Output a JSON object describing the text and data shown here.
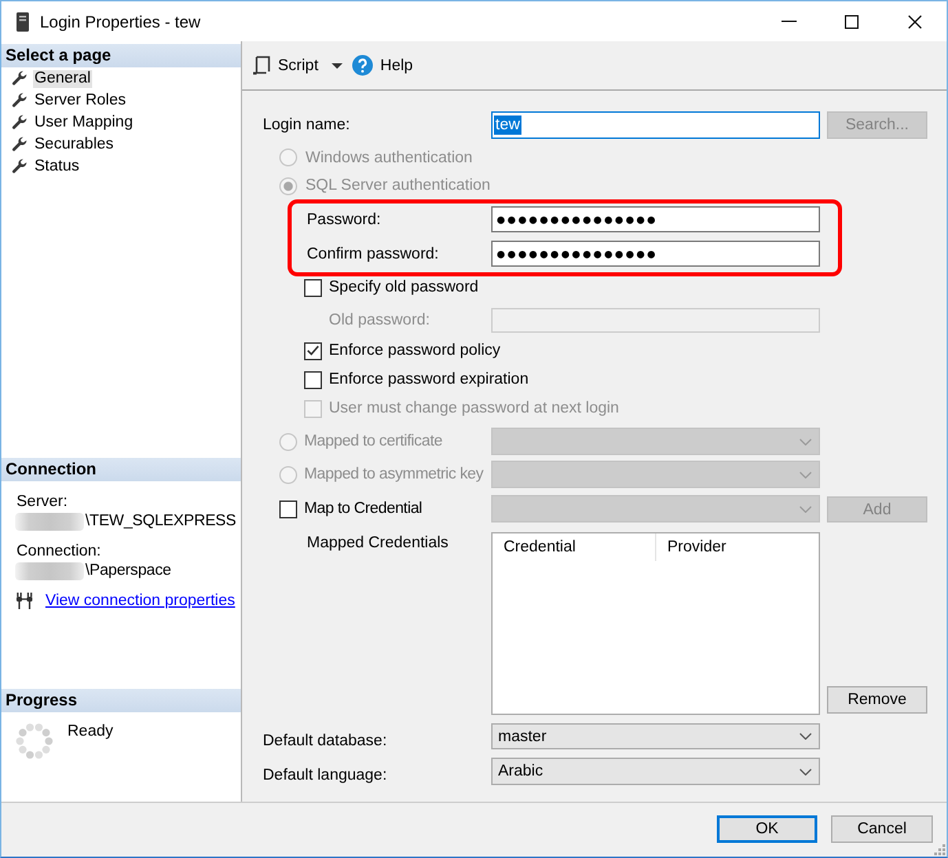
{
  "window": {
    "title": "Login Properties - tew"
  },
  "select_page": {
    "title": "Select a page",
    "items": [
      {
        "label": "General",
        "selected": true
      },
      {
        "label": "Server Roles",
        "selected": false
      },
      {
        "label": "User Mapping",
        "selected": false
      },
      {
        "label": "Securables",
        "selected": false
      },
      {
        "label": "Status",
        "selected": false
      }
    ]
  },
  "connection": {
    "title": "Connection",
    "lines": [
      {
        "kind": "caption",
        "text": "Server:",
        "redacted": false
      },
      {
        "kind": "detail",
        "text": "\\TEW_SQLEXPRESS",
        "redacted": true
      },
      {
        "kind": "caption",
        "text": "Connection:",
        "redacted": false
      },
      {
        "kind": "detail",
        "text": "\\Paperspace",
        "redacted": true
      }
    ],
    "link": "View connection properties"
  },
  "progress": {
    "title": "Progress",
    "status": "Ready"
  },
  "toolbar": [
    {
      "kind": "script",
      "label": "Script"
    },
    {
      "kind": "help",
      "label": "Help"
    }
  ],
  "login_name": {
    "label": "Login name:",
    "value": "tew",
    "value_selected": true,
    "button": {
      "label": "Search...",
      "disabled": true
    }
  },
  "authentication": [
    {
      "label": "Windows authentication",
      "selected": false,
      "disabled": true
    },
    {
      "label": "SQL Server authentication",
      "selected": true,
      "disabled": true
    }
  ],
  "password_group": {
    "highlighted": true,
    "fields": [
      {
        "label": "Password:",
        "value": "●●●●●●●●●●●●●●●"
      },
      {
        "label": "Confirm password:",
        "value": "●●●●●●●●●●●●●●●"
      }
    ]
  },
  "old_password": {
    "checkbox": {
      "label": "Specify old password",
      "checked": false
    },
    "label": "Old password:",
    "disabled": true
  },
  "policy_options": [
    {
      "label": "Enforce password policy",
      "checked": true,
      "disabled": false
    },
    {
      "label": "Enforce password expiration",
      "checked": false,
      "disabled": false
    },
    {
      "label": "User must change password at next login",
      "checked": false,
      "disabled": true
    }
  ],
  "mapping": [
    {
      "kind": "radio",
      "label": "Mapped to certificate",
      "selected": false,
      "disabled": true,
      "dropdown_disabled": true
    },
    {
      "kind": "radio",
      "label": "Mapped to asymmetric key",
      "selected": false,
      "disabled": true,
      "dropdown_disabled": true
    },
    {
      "kind": "checkbox",
      "label": "Map to Credential",
      "checked": false,
      "disabled": false,
      "dropdown_disabled": true,
      "button": {
        "label": "Add",
        "disabled": true
      }
    }
  ],
  "mapped_credentials": {
    "label": "Mapped Credentials",
    "columns": [
      "Credential",
      "Provider"
    ],
    "button": {
      "label": "Remove",
      "disabled": false
    }
  },
  "defaults": [
    {
      "label": "Default database:",
      "value": "master"
    },
    {
      "label": "Default language:",
      "value": "Arabic"
    }
  ],
  "buttons": [
    {
      "label": "OK",
      "focused": true
    },
    {
      "label": "Cancel",
      "focused": false
    }
  ]
}
